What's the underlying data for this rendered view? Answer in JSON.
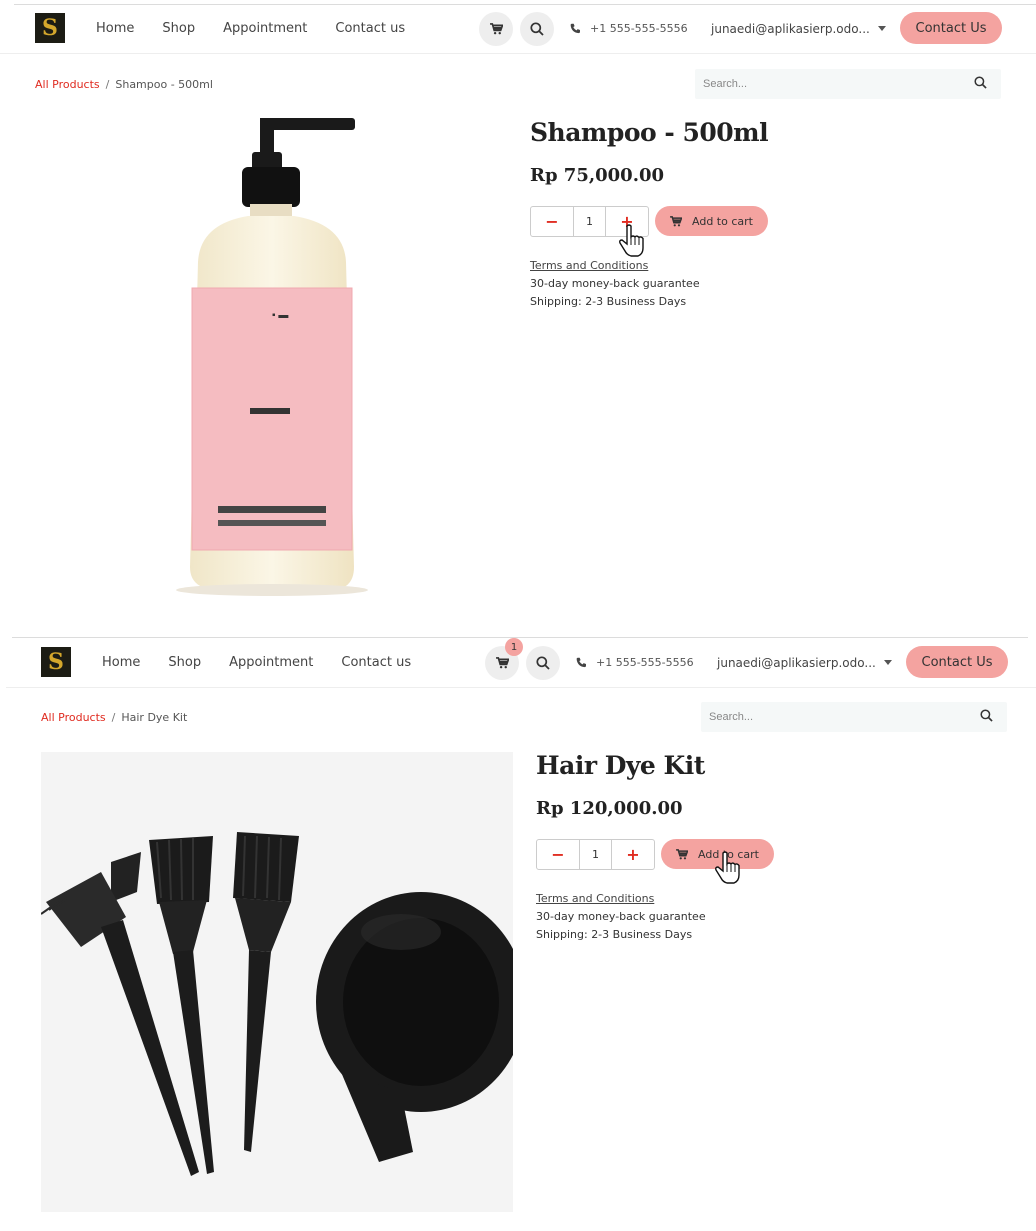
{
  "brand": {
    "logo_letter": "S"
  },
  "nav": {
    "items": [
      "Home",
      "Shop",
      "Appointment",
      "Contact us"
    ],
    "phone": "+1 555-555-5556",
    "account": "junaedi@aplikasierp.odo...",
    "contact_button": "Contact Us",
    "search_placeholder": "Search..."
  },
  "colors": {
    "accent": "#f4a3a0",
    "link_red": "#e02b20",
    "text_dark": "#222222"
  },
  "icons": [
    "cart-icon",
    "search-icon",
    "phone-icon",
    "minus-icon",
    "plus-icon",
    "hand-cursor-icon"
  ],
  "screens": [
    {
      "cart_badge": "",
      "breadcrumb": {
        "root": "All Products",
        "separator": "/",
        "current": "Shampoo - 500ml"
      },
      "product": {
        "name": "Shampoo - 500ml",
        "price": "Rp 75,000.00",
        "quantity": "1",
        "add_to_cart": "Add to cart",
        "terms_link": "Terms and Conditions",
        "guarantee": "30-day money-back guarantee",
        "shipping": "Shipping: 2-3 Business Days"
      }
    },
    {
      "cart_badge": "1",
      "breadcrumb": {
        "root": "All Products",
        "separator": "/",
        "current": "Hair Dye Kit"
      },
      "product": {
        "name": "Hair Dye Kit",
        "price": "Rp 120,000.00",
        "quantity": "1",
        "add_to_cart": "Add to cart",
        "terms_link": "Terms and Conditions",
        "guarantee": "30-day money-back guarantee",
        "shipping": "Shipping: 2-3 Business Days"
      }
    }
  ]
}
